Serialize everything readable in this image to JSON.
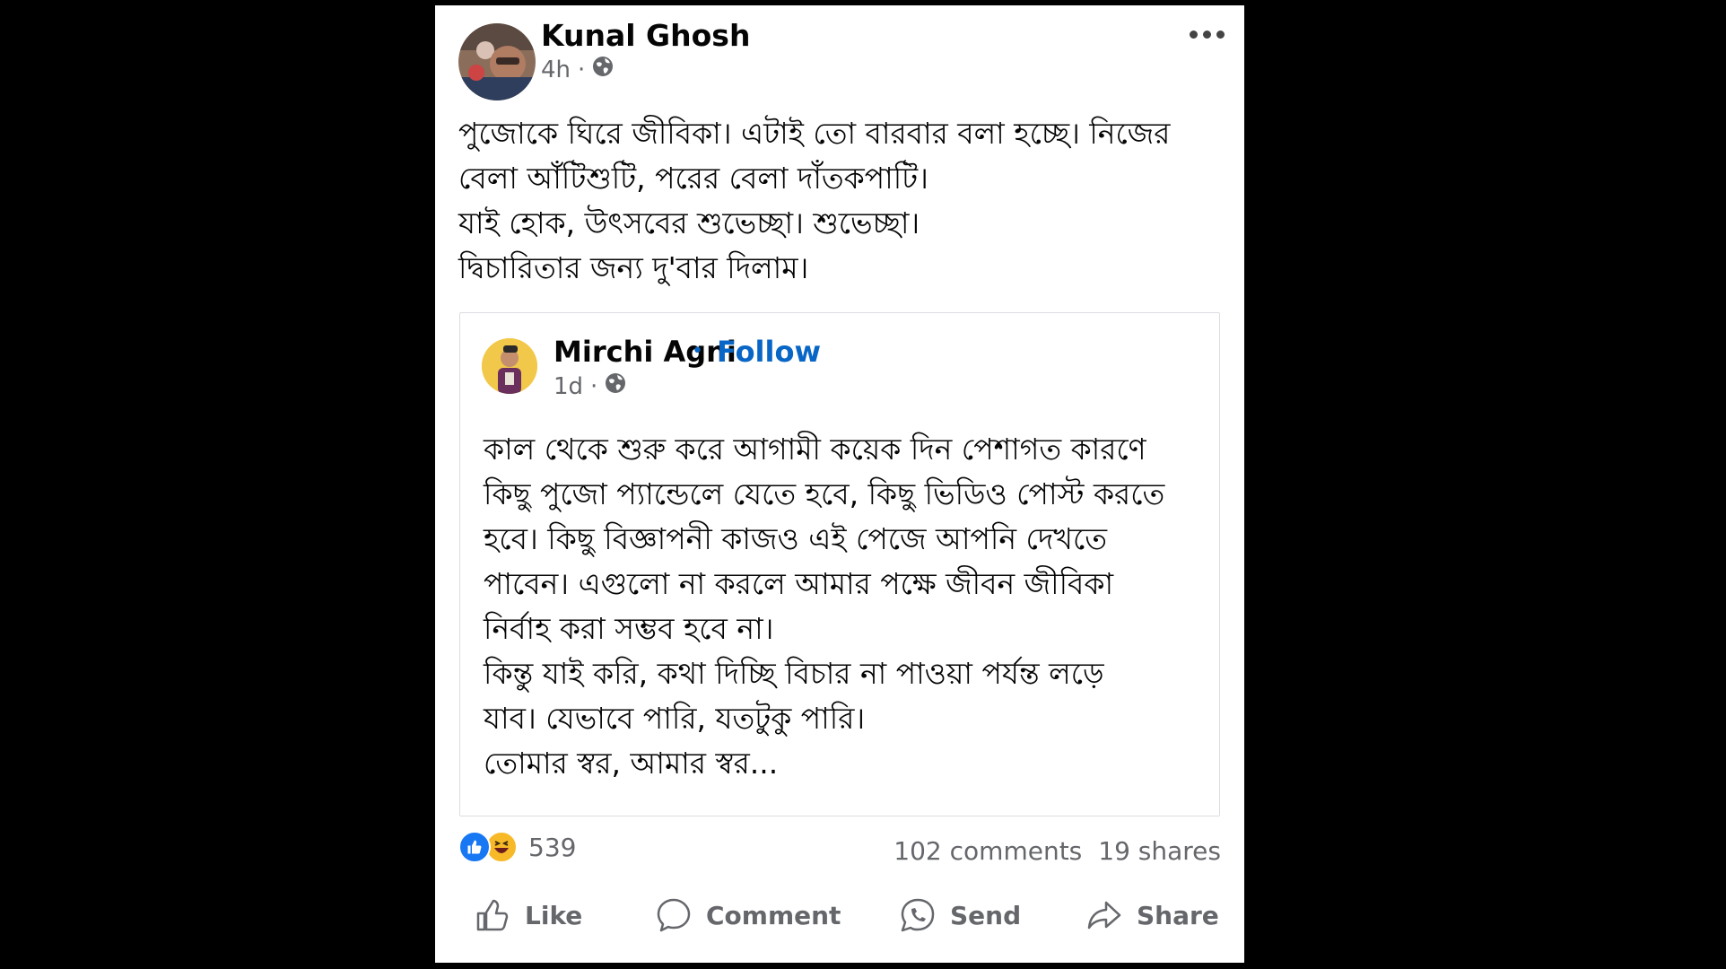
{
  "post": {
    "author": "Kunal Ghosh",
    "time": "4h",
    "separator": "·",
    "text_lines": [
      "পুজোকে ঘিরে জীবিকা। এটাই তো বারবার বলা হচ্ছে। নিজের",
      "বেলা আঁটিশুটি, পরের বেলা দাঁতকপাটি।",
      "যাই হোক, উৎসবের শুভেচ্ছা। শুভেচ্ছা।",
      "দ্বিচারিতার জন্য দু'বার দিলাম।"
    ]
  },
  "shared": {
    "author": "Mirchi Agni",
    "dot": "•",
    "follow_label": "Follow",
    "time": "1d",
    "separator": "·",
    "text_lines": [
      "কাল থেকে শুরু করে আগামী কয়েক দিন পেশাগত কারণে",
      "কিছু পুজো প্যান্ডেলে যেতে হবে, কিছু ভিডিও পোস্ট করতে",
      "হবে। কিছু বিজ্ঞাপনী কাজও এই পেজে আপনি দেখতে",
      "পাবেন। এগুলো না করলে আমার পক্ষে জীবন জীবিকা",
      "নির্বাহ করা সম্ভব হবে না।",
      "কিন্তু যাই করি, কথা দিচ্ছি বিচার না পাওয়া পর্যন্ত লড়ে",
      "যাব। যেভাবে পারি,  যতটুকু পারি।",
      "তোমার স্বর, আমার স্বর..."
    ]
  },
  "stats": {
    "reaction_count": "539",
    "comments": "102 comments",
    "shares": "19 shares"
  },
  "actions": {
    "like": "Like",
    "comment": "Comment",
    "send": "Send",
    "share": "Share"
  },
  "colors": {
    "follow": "#0866c6",
    "like_blue": "#1877f2",
    "haha_yellow": "#f7b928",
    "muted": "#65676b"
  }
}
